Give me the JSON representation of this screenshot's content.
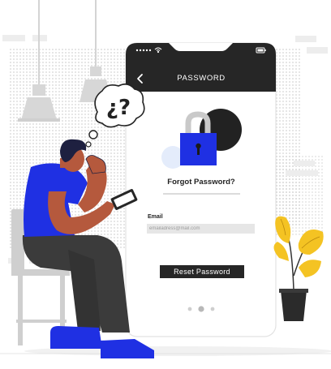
{
  "header": {
    "title": "PASSWORD",
    "back_icon": "chevron-left-icon"
  },
  "form": {
    "heading": "Forgot Password?",
    "email_label": "Email",
    "email_placeholder": "emailadress@mail.com",
    "email_value": "",
    "submit_label": "Reset Password"
  },
  "pager": {
    "total": 3,
    "active": 2
  },
  "thought_bubble": {
    "text": "¿?"
  },
  "colors": {
    "accent": "#1f30e3",
    "header": "#262626",
    "skin": "#b5593d",
    "plant": "#f4c323",
    "pattern": "#d9d9d9"
  },
  "icons": [
    "status-dots-icon",
    "wifi-icon",
    "battery-icon",
    "padlock-icon",
    "chevron-left-icon"
  ]
}
